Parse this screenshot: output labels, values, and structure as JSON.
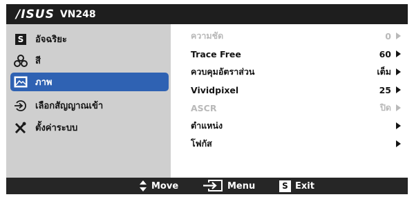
{
  "header": {
    "brand": "/ISUS",
    "model": "VN248"
  },
  "sidebar": {
    "items": [
      {
        "label": "อัจฉริยะ",
        "icon": "splendid-s-icon",
        "active": false
      },
      {
        "label": "สี",
        "icon": "color-circles-icon",
        "active": false
      },
      {
        "label": "ภาพ",
        "icon": "image-icon",
        "active": true
      },
      {
        "label": "เลือกสัญญาณเข้า",
        "icon": "input-select-icon",
        "active": false
      },
      {
        "label": "ตั้งค่าระบบ",
        "icon": "system-setup-tools-icon",
        "active": false
      }
    ]
  },
  "settings": [
    {
      "label": "ความชัด",
      "value": "0",
      "enabled": false
    },
    {
      "label": "Trace Free",
      "value": "60",
      "enabled": true
    },
    {
      "label": "ควบคุมอัตราส่วน",
      "value": "เต็ม",
      "enabled": true
    },
    {
      "label": "Vividpixel",
      "value": "25",
      "enabled": true
    },
    {
      "label": "ASCR",
      "value": "ปิด",
      "enabled": false
    },
    {
      "label": "ตำแหน่ง",
      "value": "",
      "enabled": true
    },
    {
      "label": "โฟกัส",
      "value": "",
      "enabled": true
    }
  ],
  "footer": {
    "move_label": "Move",
    "menu_label": "Menu",
    "exit_label": "Exit",
    "exit_badge": "S"
  },
  "colors": {
    "titlebar": "#1e1e1e",
    "sidebar_bg": "#cfcfcf",
    "active_item": "#2f62b3",
    "disabled_text": "#b9b9b9",
    "footer": "#262626"
  }
}
